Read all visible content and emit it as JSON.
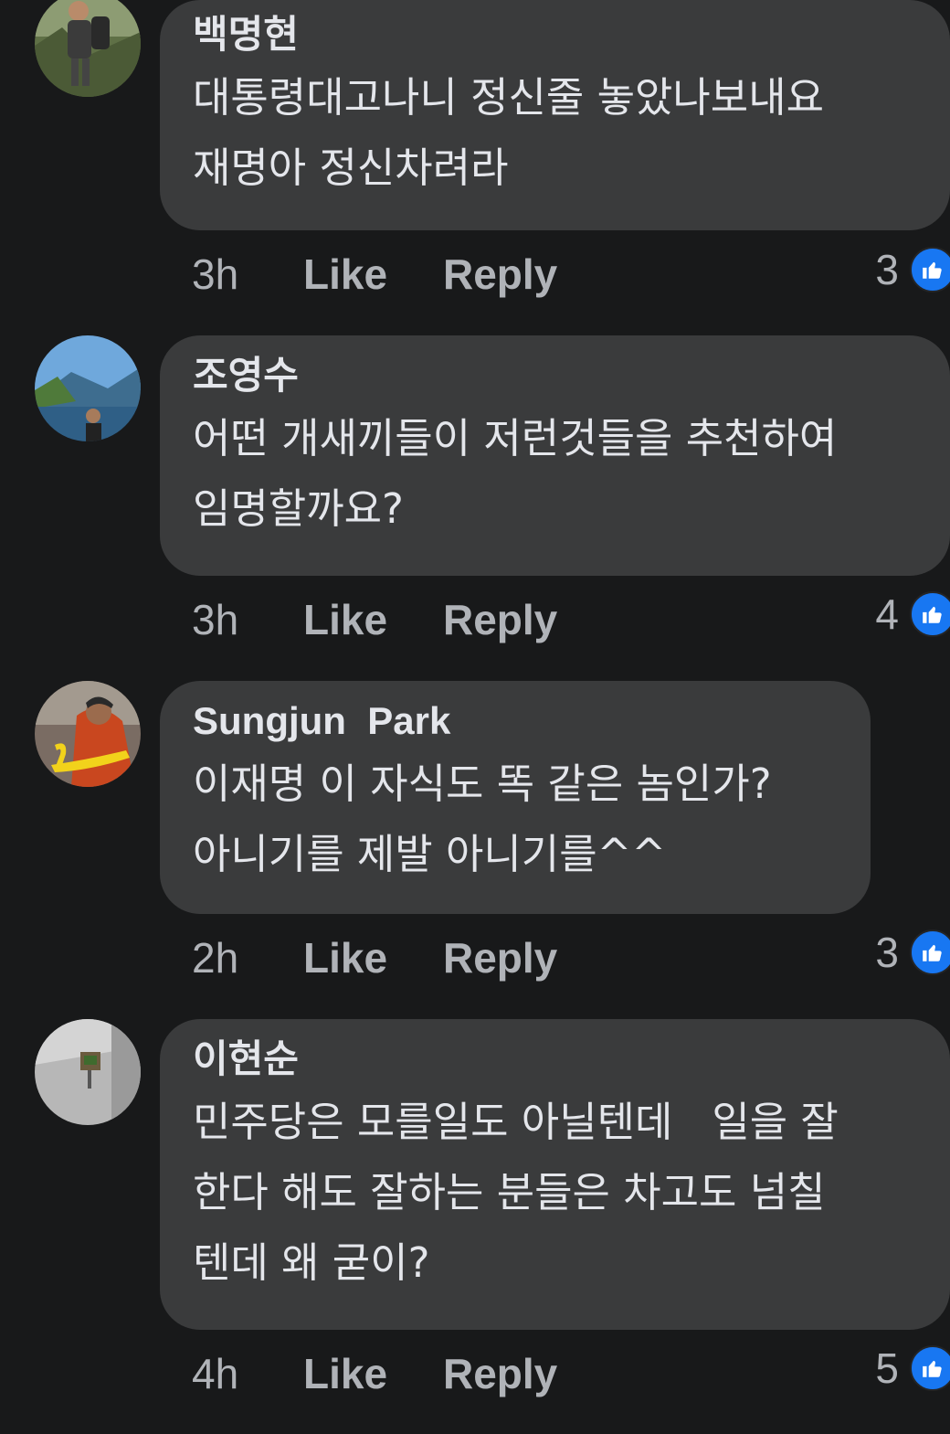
{
  "comments": [
    {
      "author": "백명현",
      "lines": [
        "대통령대고나니 정신줄 놓았나보내요",
        "재명아 정신차려라"
      ],
      "time": "3h",
      "like_label": "Like",
      "reply_label": "Reply",
      "reaction_count": "3",
      "reaction_icon": "thumbs-up-icon"
    },
    {
      "author": "조영수",
      "lines": [
        "어떤 개새끼들이 저런것들을 추천하여",
        "임명할까요?"
      ],
      "time": "3h",
      "like_label": "Like",
      "reply_label": "Reply",
      "reaction_count": "4",
      "reaction_icon": "thumbs-up-icon"
    },
    {
      "author": "Sungjun  Park",
      "lines": [
        "이재명 이 자식도 똑 같은 놈인가?",
        "아니기를 제발 아니기를^^"
      ],
      "time": "2h",
      "like_label": "Like",
      "reply_label": "Reply",
      "reaction_count": "3",
      "reaction_icon": "thumbs-up-icon"
    },
    {
      "author": "이현순",
      "lines": [
        "민주당은 모를일도 아닐텐데   일을 잘",
        "한다 해도 잘하는 분들은 차고도 넘칠",
        "텐데 왜 굳이?"
      ],
      "time": "4h",
      "like_label": "Like",
      "reply_label": "Reply",
      "reaction_count": "5",
      "reaction_icon": "thumbs-up-icon"
    }
  ],
  "colors": {
    "background": "#18191a",
    "bubble": "#3a3b3c",
    "text": "#e4e6eb",
    "secondary_text": "#b0b3b8",
    "like_blue": "#1877f2"
  }
}
